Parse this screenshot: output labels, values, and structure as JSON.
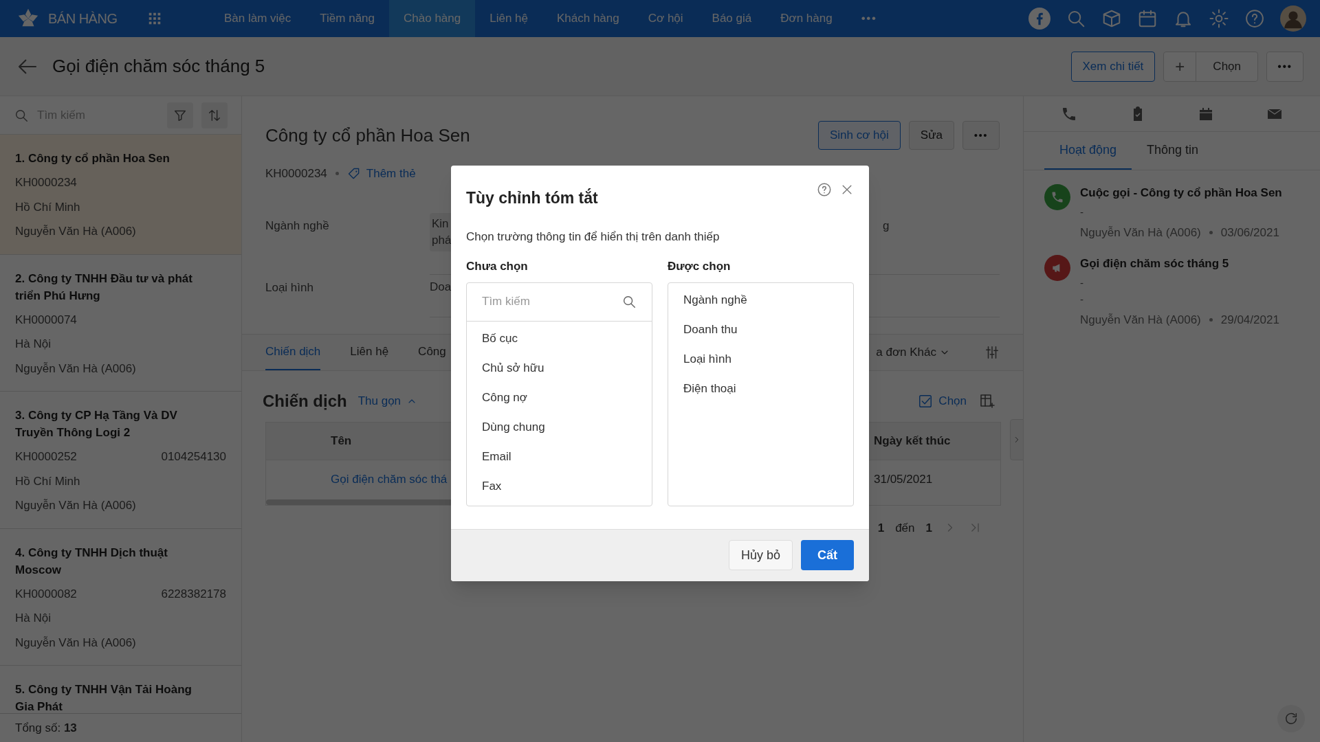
{
  "nav": {
    "brand": "BÁN HÀNG",
    "more": "•••",
    "items": [
      {
        "label": "Bàn làm việc",
        "selected": false
      },
      {
        "label": "Tiềm năng",
        "selected": false
      },
      {
        "label": "Chào hàng",
        "selected": true
      },
      {
        "label": "Liên hệ",
        "selected": false
      },
      {
        "label": "Khách hàng",
        "selected": false
      },
      {
        "label": "Cơ hội",
        "selected": false
      },
      {
        "label": "Báo giá",
        "selected": false
      },
      {
        "label": "Đơn hàng",
        "selected": false
      }
    ]
  },
  "header": {
    "title": "Gọi điện chăm sóc tháng 5",
    "view_detail": "Xem chi tiết",
    "add": "+",
    "choose": "Chọn",
    "more": "•••"
  },
  "list": {
    "search_placeholder": "Tìm kiếm",
    "total": "Tổng số: **13**",
    "items": [
      {
        "title": "1. Công ty cổ phần Hoa Sen",
        "code": "KH0000234",
        "city": "Hồ Chí Minh",
        "owner": "Nguyễn Văn Hà (A006)",
        "selected": true
      },
      {
        "title": "2. Công ty TNHH Đầu tư và phát triển Phú Hưng",
        "code": "KH0000074",
        "city": "Hà Nội",
        "owner": "Nguyễn Văn Hà (A006)",
        "selected": false
      },
      {
        "title": "3. Công ty CP Hạ Tầng Và DV Truyền Thông Logi 2",
        "code": "KH0000252",
        "phone": "0104254130",
        "city": "Hồ Chí Minh",
        "owner": "Nguyễn Văn Hà (A006)",
        "selected": false
      },
      {
        "title": "4. Công ty TNHH Dịch thuật Moscow",
        "code": "KH0000082",
        "phone": "6228382178",
        "city": "Hà Nội",
        "owner": "Nguyễn Văn Hà (A006)",
        "selected": false
      },
      {
        "title": "5. Công ty TNHH Vận Tải Hoàng Gia Phát",
        "selected": false
      }
    ]
  },
  "record": {
    "title": "Công ty cổ phần Hoa Sen",
    "generate": "Sinh cơ hội",
    "edit": "Sửa",
    "more": "•••",
    "code": "KH0000234",
    "tag_link": "Thêm thẻ",
    "fields": [
      {
        "label": "Ngành nghề",
        "value_lines": [
          "Kin",
          "phá"
        ],
        "column_2_value": "g"
      },
      {
        "label": "Loại hình",
        "value_lines": [
          "Doa"
        ]
      }
    ],
    "tabs": [
      {
        "label": "Chiến dịch",
        "selected": true
      },
      {
        "label": "Liên hệ",
        "selected": false
      },
      {
        "label": "Công",
        "selected": false
      }
    ],
    "more_tab": "a đơn Khác",
    "section": {
      "title": "Chiến dịch",
      "collapse": "Thu gọn",
      "choose": "Chọn"
    },
    "table": {
      "columns": [
        "Tên",
        "Ngày kết thúc"
      ],
      "rows": [
        [
          "Gọi điện chăm sóc thá",
          "31/05/2021"
        ]
      ]
    },
    "pagination": {
      "from": "1",
      "to_label": "đến",
      "to": "1"
    }
  },
  "activity_panel": {
    "tabs": [
      {
        "label": "Hoạt động",
        "selected": true
      },
      {
        "label": "Thông tin",
        "selected": false
      }
    ],
    "items": [
      {
        "kind": "call",
        "title": "Cuộc gọi - Công ty cổ phần Hoa Sen",
        "lines": [
          "-"
        ],
        "owner": "Nguyễn Văn Hà (A006)",
        "date": "03/06/2021"
      },
      {
        "kind": "campaign",
        "title": "Gọi điện chăm sóc tháng 5",
        "lines": [
          "-",
          "-"
        ],
        "owner": "Nguyễn Văn Hà (A006)",
        "date": "29/04/2021"
      }
    ]
  },
  "dialog": {
    "title": "Tùy chỉnh tóm tắt",
    "description": "Chọn trường thông tin để hiển thị trên danh thiếp",
    "available": {
      "heading": "Chưa chọn",
      "search_placeholder": "Tìm kiếm",
      "items": [
        "Bố cục",
        "Chủ sở hữu",
        "Công nợ",
        "Dùng chung",
        "Email",
        "Fax"
      ]
    },
    "chosen": {
      "heading": "Được chọn",
      "items": [
        "Ngành nghề",
        "Doanh thu",
        "Loại hình",
        "Điện thoại"
      ]
    },
    "cancel": "Hủy bỏ",
    "save": "Cất"
  }
}
